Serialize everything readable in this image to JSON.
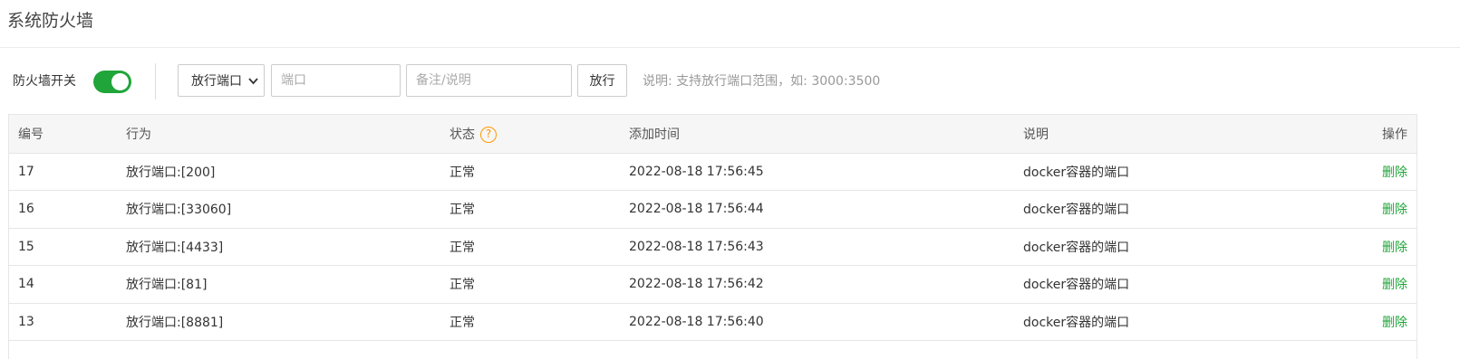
{
  "page": {
    "title": "系统防火墙"
  },
  "toolbar": {
    "firewall_label": "防火墙开关",
    "firewall_enabled": true,
    "action_select": {
      "selected": "放行端口"
    },
    "port_input": {
      "placeholder": "端口",
      "value": ""
    },
    "note_input": {
      "placeholder": "备注/说明",
      "value": ""
    },
    "allow_button_label": "放行",
    "hint": "说明: 支持放行端口范围，如: 3000:3500"
  },
  "table": {
    "headers": {
      "id": "编号",
      "action": "行为",
      "status": "状态",
      "status_help": "?",
      "added_time": "添加时间",
      "note": "说明",
      "operation": "操作"
    },
    "rows": [
      {
        "id": "17",
        "action": "放行端口:[200]",
        "status": "正常",
        "added_time": "2022-08-18 17:56:45",
        "note": "docker容器的端口",
        "op": "删除"
      },
      {
        "id": "16",
        "action": "放行端口:[33060]",
        "status": "正常",
        "added_time": "2022-08-18 17:56:44",
        "note": "docker容器的端口",
        "op": "删除"
      },
      {
        "id": "15",
        "action": "放行端口:[4433]",
        "status": "正常",
        "added_time": "2022-08-18 17:56:43",
        "note": "docker容器的端口",
        "op": "删除"
      },
      {
        "id": "14",
        "action": "放行端口:[81]",
        "status": "正常",
        "added_time": "2022-08-18 17:56:42",
        "note": "docker容器的端口",
        "op": "删除"
      },
      {
        "id": "13",
        "action": "放行端口:[8881]",
        "status": "正常",
        "added_time": "2022-08-18 17:56:40",
        "note": "docker容器的端口",
        "op": "删除"
      }
    ]
  },
  "colors": {
    "accent_green": "#20a53a",
    "help_orange": "#ff9900"
  },
  "icons": {
    "select_arrow": "chevron-down-icon",
    "status_help": "question-circle-icon"
  }
}
